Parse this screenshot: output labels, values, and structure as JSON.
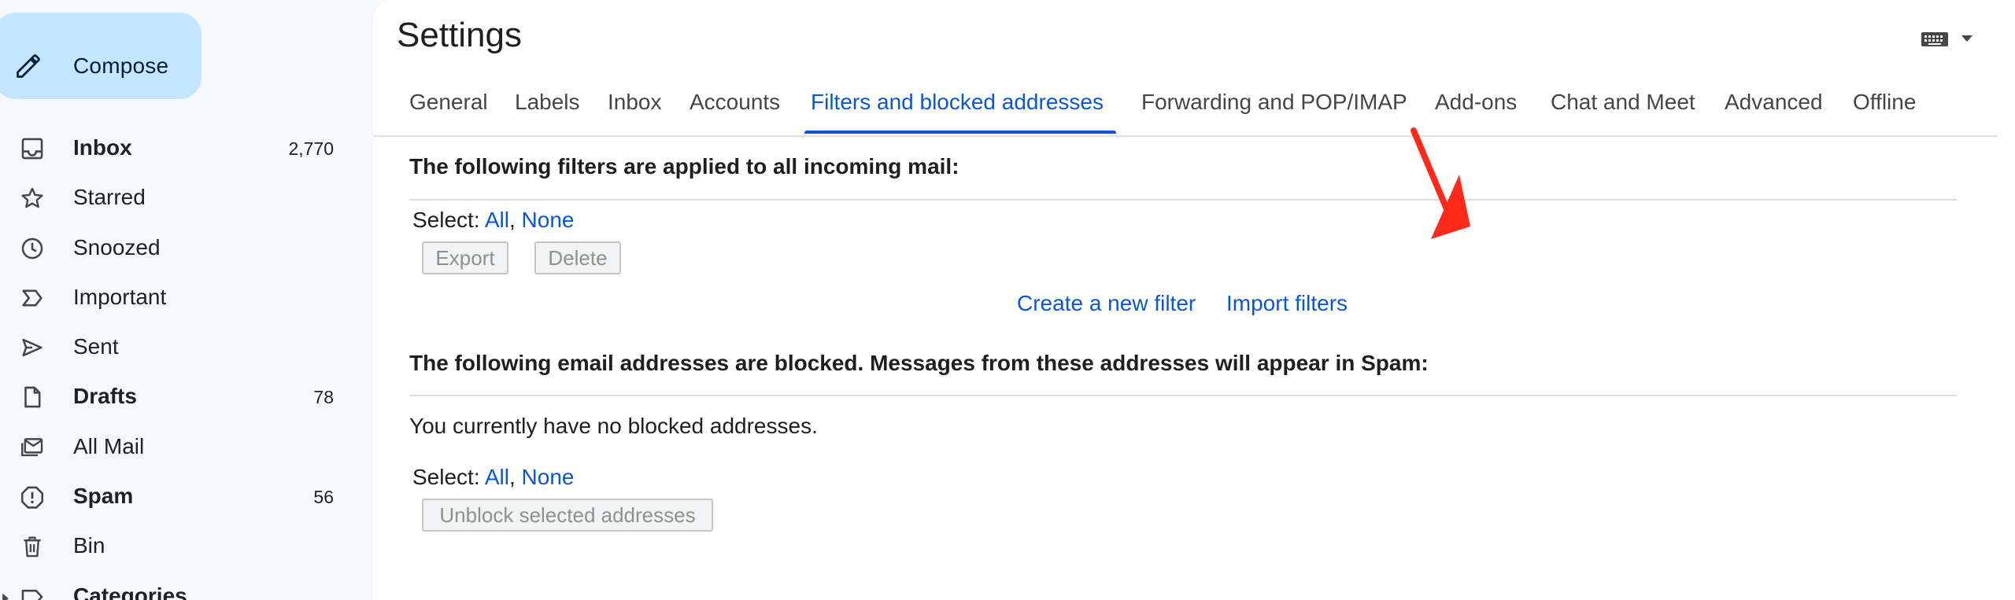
{
  "sidebar": {
    "compose_label": "Compose",
    "items": [
      {
        "label": "Inbox",
        "count": "2,770",
        "bold": true,
        "icon": "inbox-icon"
      },
      {
        "label": "Starred",
        "count": "",
        "bold": false,
        "icon": "star-icon"
      },
      {
        "label": "Snoozed",
        "count": "",
        "bold": false,
        "icon": "clock-icon"
      },
      {
        "label": "Important",
        "count": "",
        "bold": false,
        "icon": "important-icon"
      },
      {
        "label": "Sent",
        "count": "",
        "bold": false,
        "icon": "send-icon"
      },
      {
        "label": "Drafts",
        "count": "78",
        "bold": true,
        "icon": "draft-icon"
      },
      {
        "label": "All Mail",
        "count": "",
        "bold": false,
        "icon": "all-mail-icon"
      },
      {
        "label": "Spam",
        "count": "56",
        "bold": true,
        "icon": "spam-icon"
      },
      {
        "label": "Bin",
        "count": "",
        "bold": false,
        "icon": "trash-icon"
      },
      {
        "label": "Categories",
        "count": "",
        "bold": true,
        "icon": "label-icon"
      }
    ]
  },
  "settings": {
    "title": "Settings",
    "tabs": [
      {
        "label": "General"
      },
      {
        "label": "Labels"
      },
      {
        "label": "Inbox"
      },
      {
        "label": "Accounts"
      },
      {
        "label": "Filters and blocked addresses"
      },
      {
        "label": "Forwarding and POP/IMAP"
      },
      {
        "label": "Add-ons"
      },
      {
        "label": "Chat and Meet"
      },
      {
        "label": "Advanced"
      },
      {
        "label": "Offline"
      }
    ],
    "active_tab": "Filters and blocked addresses",
    "filters": {
      "heading": "The following filters are applied to all incoming mail:",
      "select_label": "Select:",
      "select_all": "All",
      "select_sep": ",",
      "select_none": "None",
      "export_label": "Export",
      "delete_label": "Delete",
      "create_filter": "Create a new filter",
      "import_filters": "Import filters"
    },
    "blocked": {
      "heading": "The following email addresses are blocked. Messages from these addresses will appear in Spam:",
      "empty_message": "You currently have no blocked addresses.",
      "select_label": "Select:",
      "select_all": "All",
      "select_sep": ",",
      "select_none": "None",
      "unblock_label": "Unblock selected addresses"
    }
  },
  "colors": {
    "accent": "#0b57d0",
    "compose_bg": "#c2e7ff",
    "annotation_arrow": "#ff2a1a"
  }
}
